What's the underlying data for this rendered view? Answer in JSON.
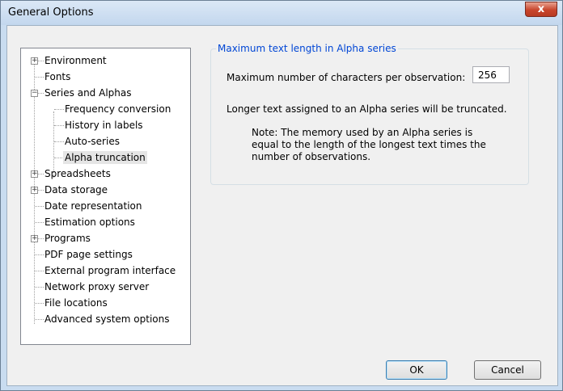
{
  "window": {
    "title": "General Options",
    "close_label": "x"
  },
  "tree": {
    "items": [
      {
        "label": "Environment",
        "expander": "+"
      },
      {
        "label": "Fonts"
      },
      {
        "label": "Series and Alphas",
        "expander": "-"
      },
      {
        "label": "Frequency conversion"
      },
      {
        "label": "History in labels"
      },
      {
        "label": "Auto-series"
      },
      {
        "label": "Alpha truncation",
        "selected": true
      },
      {
        "label": "Spreadsheets",
        "expander": "+"
      },
      {
        "label": "Data storage",
        "expander": "+"
      },
      {
        "label": "Date representation"
      },
      {
        "label": "Estimation options"
      },
      {
        "label": "Programs",
        "expander": "+"
      },
      {
        "label": "PDF page settings"
      },
      {
        "label": "External program interface"
      },
      {
        "label": "Network proxy server"
      },
      {
        "label": "File locations"
      },
      {
        "label": "Advanced system options"
      }
    ]
  },
  "panel": {
    "group_title": "Maximum text length in Alpha series",
    "max_chars_label": "Maximum number of characters per observation:",
    "max_chars_value": "256",
    "info": "Longer text assigned to an Alpha series will be truncated.",
    "note_line1": "Note: The memory used by an Alpha series is",
    "note_line2": "equal to the length of the longest text times the",
    "note_line3": "number of observations."
  },
  "buttons": {
    "ok": "OK",
    "cancel": "Cancel"
  }
}
